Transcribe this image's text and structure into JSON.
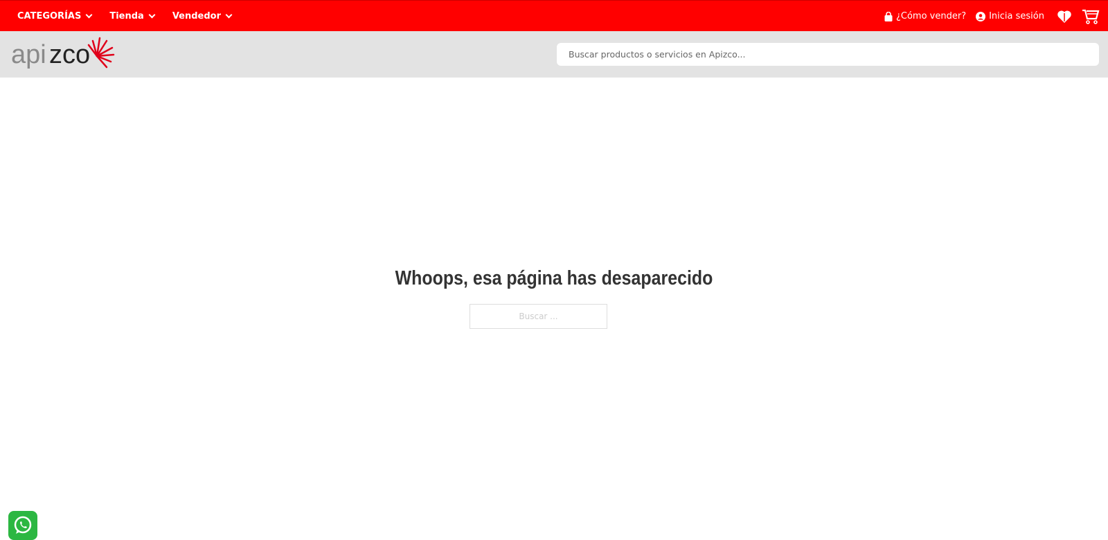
{
  "topbar": {
    "nav": [
      {
        "label": "CATEGORÍAS"
      },
      {
        "label": "Tienda"
      },
      {
        "label": "Vendedor"
      }
    ],
    "sell_label": "¿Cómo vender?",
    "login_label": "Inicia sesión"
  },
  "header": {
    "logo_text": "apizco",
    "search_placeholder": "Buscar productos o servicios en Apizco..."
  },
  "main": {
    "title": "Whoops, esa página has desaparecido",
    "search_placeholder": "Buscar ..."
  },
  "colors": {
    "brand": "#ff0000",
    "header_bg": "#e3e3e3",
    "whatsapp": "#2cb742"
  }
}
